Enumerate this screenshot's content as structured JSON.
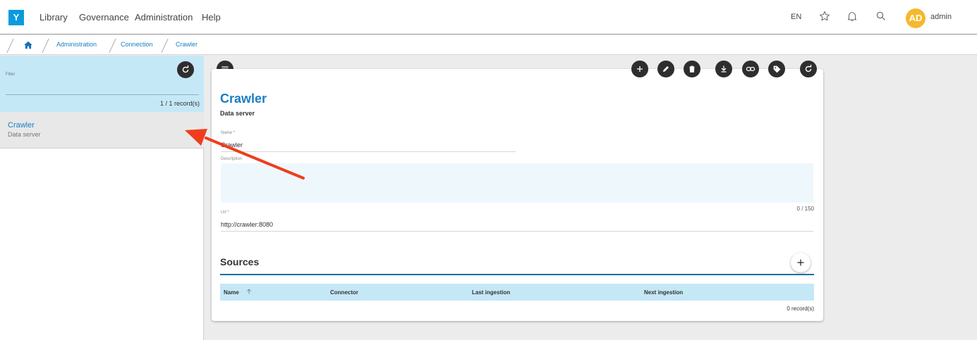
{
  "app": {
    "logo_letter": "Y"
  },
  "nav": {
    "items": [
      {
        "label": "Library"
      },
      {
        "label": "Governance"
      },
      {
        "label": "Administration"
      },
      {
        "label": "Help"
      }
    ]
  },
  "header": {
    "language": "EN",
    "user": {
      "initials": "AD",
      "name": "admin"
    },
    "icons": [
      "star-icon",
      "bell-icon",
      "search-icon"
    ],
    "avatar_color": "#f5b82e"
  },
  "breadcrumb": {
    "items": [
      {
        "label": "Administration"
      },
      {
        "label": "Connection"
      },
      {
        "label": "Crawler"
      }
    ]
  },
  "left_panel": {
    "filter_label": "Filter",
    "record_count": "1 / 1 record(s)",
    "items": [
      {
        "title": "Crawler",
        "subtitle": "Data server"
      }
    ]
  },
  "detail": {
    "title": "Crawler",
    "subtitle": "Data server",
    "toolbar_icons": [
      "add-icon",
      "edit-icon",
      "delete-icon",
      "download-icon",
      "link-icon",
      "tag-icon",
      "refresh-icon"
    ],
    "fields": {
      "name": {
        "label": "Name *",
        "value": "Crawler"
      },
      "description": {
        "label": "Description",
        "value": "",
        "counter": "0 / 150"
      },
      "url": {
        "label": "Url *",
        "value": "http://crawler:8080"
      }
    },
    "sources": {
      "title": "Sources",
      "columns": [
        "Name",
        "Connector",
        "Last ingestion",
        "Next ingestion"
      ],
      "record_count": "0 record(s)"
    }
  },
  "colors": {
    "accent": "#1a7fc1",
    "logo": "#0a9bdd",
    "filter_bg": "#c5e8f7",
    "annotation_arrow": "#f03c1e"
  }
}
